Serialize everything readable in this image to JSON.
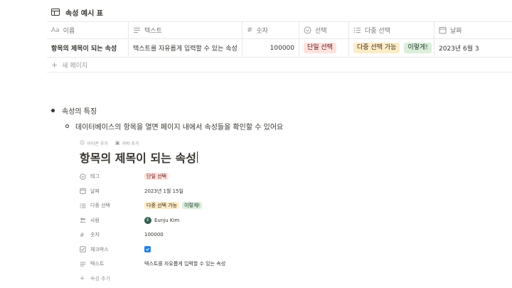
{
  "database": {
    "title": "속성 예시 표",
    "columns": [
      {
        "label": "이름",
        "icon": "text-aa-icon"
      },
      {
        "label": "텍스트",
        "icon": "lines-icon"
      },
      {
        "label": "숫자",
        "icon": "hash-icon"
      },
      {
        "label": "선택",
        "icon": "select-circle-icon"
      },
      {
        "label": "다중 선택",
        "icon": "list-icon"
      },
      {
        "label": "날짜",
        "icon": "calendar-icon"
      }
    ],
    "row": {
      "name": "항목의 제목이 되는 속성",
      "text": "텍스트를 자유롭게 입력할 수 있는 속성",
      "number": "100000",
      "select": "단일 선택",
      "multi": [
        "다중 선택 가능",
        "이렇게!"
      ],
      "date": "2023년 6월 3"
    },
    "new_page": "새 페이지"
  },
  "bullets": {
    "level1": "속성의 특징",
    "level2": "데이터베이스의 항목을 열면 페이지 내에서 속성들을 확인할 수 있어요"
  },
  "page": {
    "add_icon": "아이콘 추가",
    "add_cover": "커버 추가",
    "title": "항목의 제목이 되는 속성",
    "props": {
      "tag": {
        "label": "태그",
        "value": "단일 선택"
      },
      "date": {
        "label": "날짜",
        "value": "2023년 1월 15일"
      },
      "multi": {
        "label": "다중 선택",
        "values": [
          "다중 선택 가능",
          "이렇게!"
        ]
      },
      "person": {
        "label": "사람",
        "initial": "E",
        "value": "Eunju Kim"
      },
      "number": {
        "label": "숫자",
        "value": "100000"
      },
      "checkbox": {
        "label": "체크박스",
        "checked": true
      },
      "text": {
        "label": "텍스트",
        "value": "텍스트를 자유롭게 입력할 수 있는 속성"
      }
    },
    "add_prop": "속성 추가"
  },
  "colors": {
    "select_red": "#ffe2dd",
    "multi_yellow": "#fdecc8",
    "multi_green": "#dbeddb",
    "checkbox_blue": "#2383e2"
  }
}
